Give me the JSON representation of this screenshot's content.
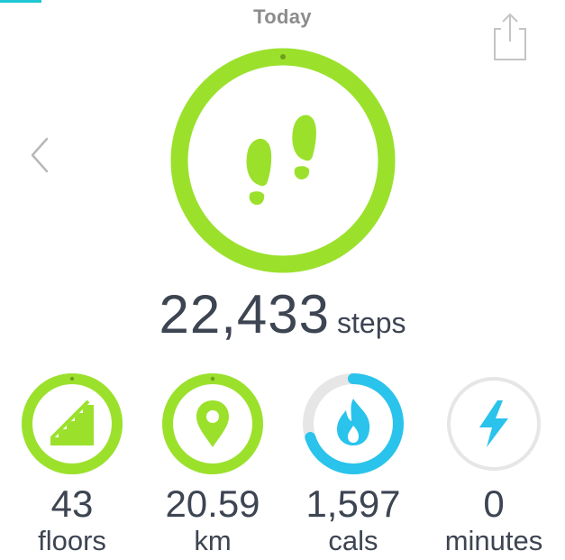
{
  "header": {
    "title": "Today"
  },
  "main": {
    "steps_value": "22,433",
    "steps_unit": "steps",
    "steps_progress": 1.0
  },
  "stats": [
    {
      "value": "43",
      "unit": "floors",
      "icon": "stairs-icon",
      "progress": 1.0
    },
    {
      "value": "20.59",
      "unit": "km",
      "icon": "location-pin-icon",
      "progress": 1.0
    },
    {
      "value": "1,597",
      "unit": "cals",
      "icon": "flame-icon",
      "progress": 0.7
    },
    {
      "value": "0",
      "unit": "minutes",
      "icon": "lightning-icon",
      "progress": 0.0
    }
  ],
  "colors": {
    "green": "#9be12c",
    "blue": "#29c3ec",
    "track": "#e6e6e6",
    "text": "#3d4452",
    "title": "#8c8c8c",
    "accent_bar": "#1ec7d3"
  }
}
